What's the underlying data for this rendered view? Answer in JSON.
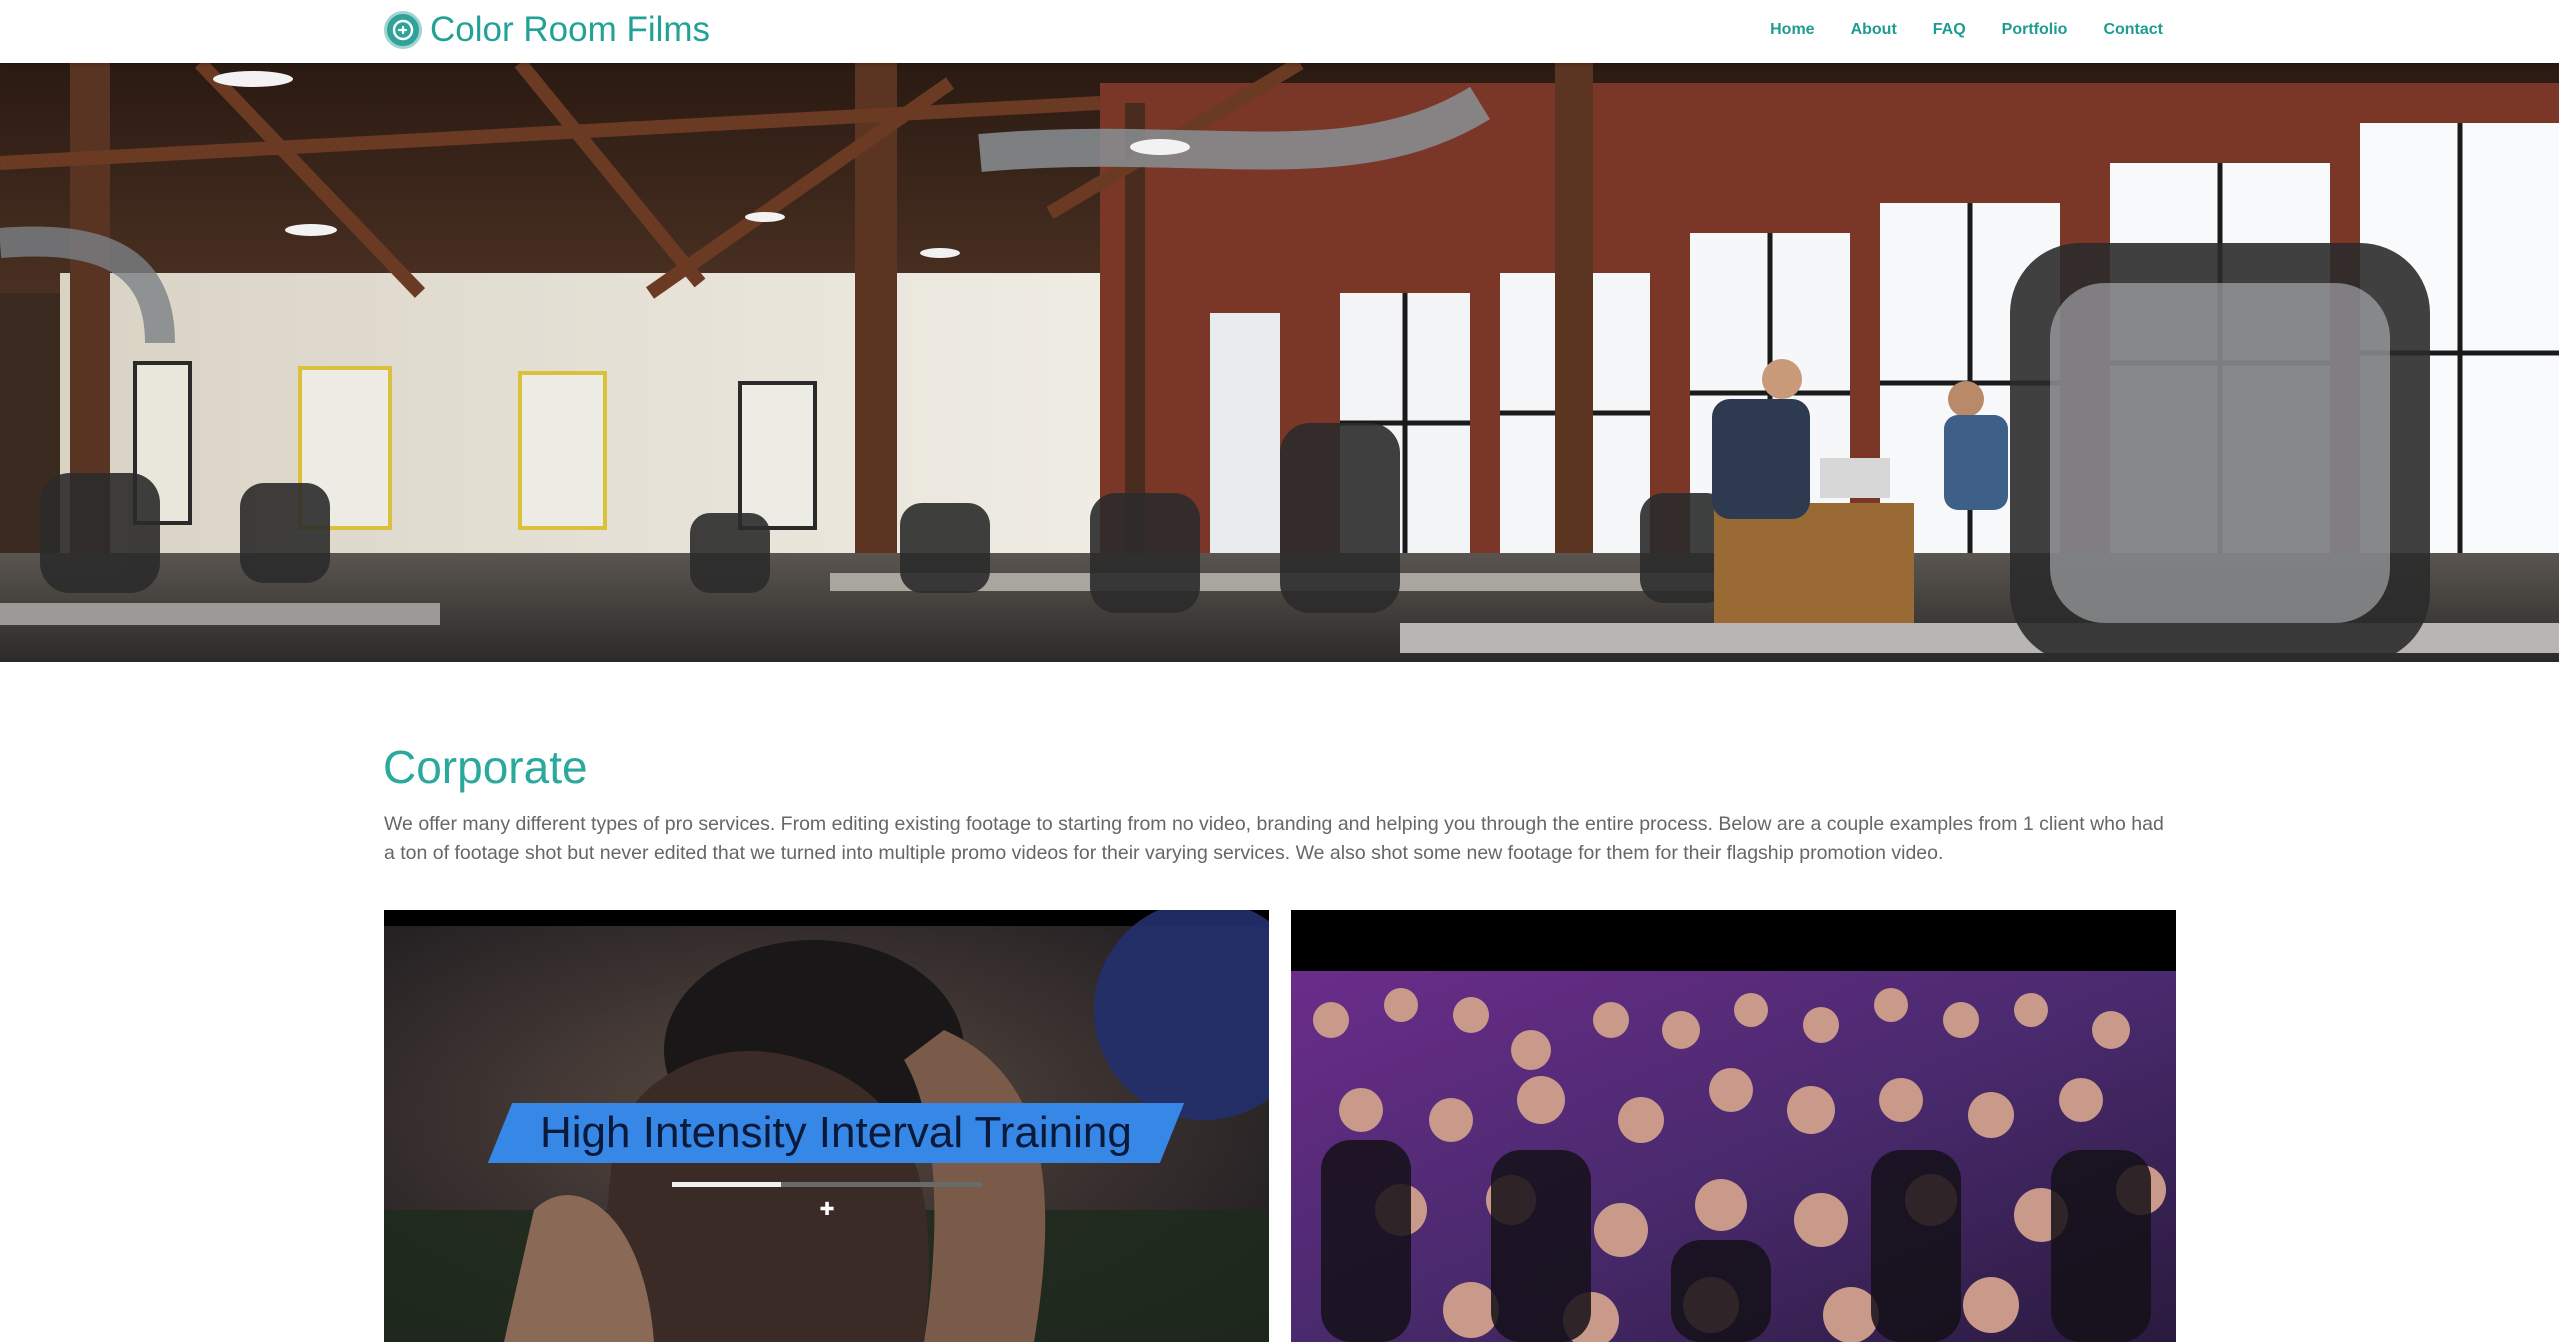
{
  "header": {
    "brand": "Color Room Films",
    "nav": [
      {
        "label": "Home"
      },
      {
        "label": "About"
      },
      {
        "label": "FAQ"
      },
      {
        "label": "Portfolio"
      },
      {
        "label": "Contact"
      }
    ]
  },
  "hero": {
    "icon": "office-photo"
  },
  "content": {
    "title": "Corporate",
    "body": "We offer many different types of pro services. From editing existing footage to starting from no video, branding and helping you through the entire process. Below are a couple examples from 1 client who had a ton of footage shot but never edited that we turned into multiple promo videos for their varying services. We also shot some new footage for them for their flagship promotion video."
  },
  "videos": [
    {
      "banner": "High Intensity Interval Training",
      "progress": 0.35
    },
    {
      "icon": "party-crowd-photo"
    }
  ],
  "colors": {
    "accent": "#2aa99c",
    "banner": "#3687e6"
  }
}
